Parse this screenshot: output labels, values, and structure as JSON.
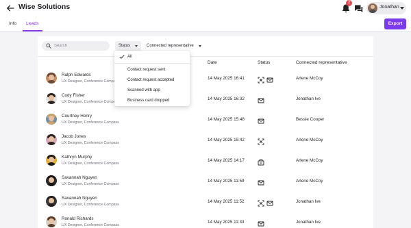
{
  "header": {
    "title": "Wise Solutions",
    "notification_count": "2",
    "user_name": "Jonathan"
  },
  "tabs": [
    {
      "label": "Info"
    },
    {
      "label": "Leads"
    }
  ],
  "export_label": "Export",
  "toolbar": {
    "search_placeholder": "Search",
    "status_filter": "Status",
    "rep_filter": "Connected representative"
  },
  "table": {
    "headers": {
      "date": "Date",
      "status": "Status",
      "rep": "Connected representative"
    },
    "rows": [
      {
        "name": "Ralph Edwards",
        "role": "UX Designer, Conference Compass",
        "date": "14 May 2025 16:41",
        "status_icons": [
          "scan-icon",
          "mail-icon"
        ],
        "rep": "Arlene McCoy"
      },
      {
        "name": "Cody Fisher",
        "role": "UX Designer, Conference Compass",
        "date": "14 May 2025 16:32",
        "status_icons": [
          "mail-icon"
        ],
        "rep": "Jonathan Ive"
      },
      {
        "name": "Courtney Henry",
        "role": "UX Designer, Conference Compass",
        "date": "14 May 2025 15:48",
        "status_icons": [
          "mail-icon"
        ],
        "rep": "Bessie Cooper"
      },
      {
        "name": "Jacob Jones",
        "role": "UX Designer, Conference Compass",
        "date": "14 May 2025 15:42",
        "status_icons": [
          "scan-icon"
        ],
        "rep": "Arlene McCoy"
      },
      {
        "name": "Kathryn Murphy",
        "role": "UX Designer, Conference Compass",
        "date": "14 May 2025 14:17",
        "status_icons": [
          "card-icon"
        ],
        "rep": "Arlene McCoy"
      },
      {
        "name": "Savannah Nguyen",
        "role": "UX Designer, Conference Compass",
        "date": "14 May 2025 11:59",
        "status_icons": [
          "mail-icon"
        ],
        "rep": "Arlene McCoy"
      },
      {
        "name": "Savannah Nguyen",
        "role": "UX Designer, Conference Compass",
        "date": "14 May 2025 11:52",
        "status_icons": [
          "scan-icon",
          "mail-icon"
        ],
        "rep": "Jonathan Ive"
      },
      {
        "name": "Ronald Richards",
        "role": "UX Designer, Conference Compass",
        "date": "14 May 2025 11:33",
        "status_icons": [
          "mail-icon"
        ],
        "rep": "Jonathan Ive"
      }
    ]
  },
  "status_dropdown": {
    "items": [
      {
        "label": "All",
        "selected": true
      },
      {
        "label": "Contact request sent"
      },
      {
        "label": "Contact request accepted"
      },
      {
        "label": "Scanned with app"
      },
      {
        "label": "Business card dropped"
      }
    ]
  },
  "colors": {
    "accent": "#7c3aed",
    "badge": "#e5484d"
  }
}
